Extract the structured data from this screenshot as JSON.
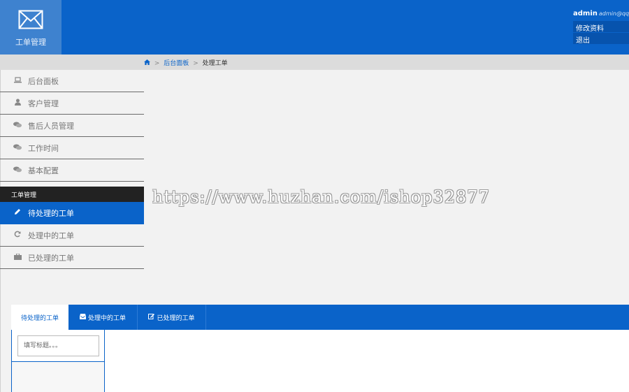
{
  "header": {
    "logo_text": "工单管理",
    "user": {
      "name": "admin",
      "email": "admin@qq.c"
    },
    "menu": [
      "修改资料",
      "退出"
    ]
  },
  "breadcrumb": {
    "home_icon": "home-icon",
    "items": [
      "后台面板",
      "处理工单"
    ],
    "separator": ">"
  },
  "sidebar": {
    "items": [
      {
        "label": "后台面板",
        "icon": "laptop-icon"
      },
      {
        "label": "客户管理",
        "icon": "user-icon"
      },
      {
        "label": "售后人员管理",
        "icon": "comments-icon"
      },
      {
        "label": "工作时间",
        "icon": "comments-icon"
      },
      {
        "label": "基本配置",
        "icon": "comments-icon"
      }
    ],
    "section_title": "工单管理",
    "section_items": [
      {
        "label": "待处理的工单",
        "icon": "pencil-icon",
        "active": true
      },
      {
        "label": "处理中的工单",
        "icon": "refresh-icon",
        "active": false
      },
      {
        "label": "已处理的工单",
        "icon": "briefcase-icon",
        "active": false
      }
    ]
  },
  "watermark": "https://www.huzhan.com/ishop32877",
  "tabs": [
    {
      "label": "待处理的工单",
      "icon": "",
      "active": true
    },
    {
      "label": "处理中的工单",
      "icon": "inbox-icon",
      "active": false
    },
    {
      "label": "已处理的工单",
      "icon": "edit-icon",
      "active": false
    }
  ],
  "search": {
    "placeholder": "填写标题。。。",
    "value": ""
  },
  "colors": {
    "primary": "#0a63c9",
    "logo_bg": "#3e82cf",
    "section_bg": "#222222"
  }
}
